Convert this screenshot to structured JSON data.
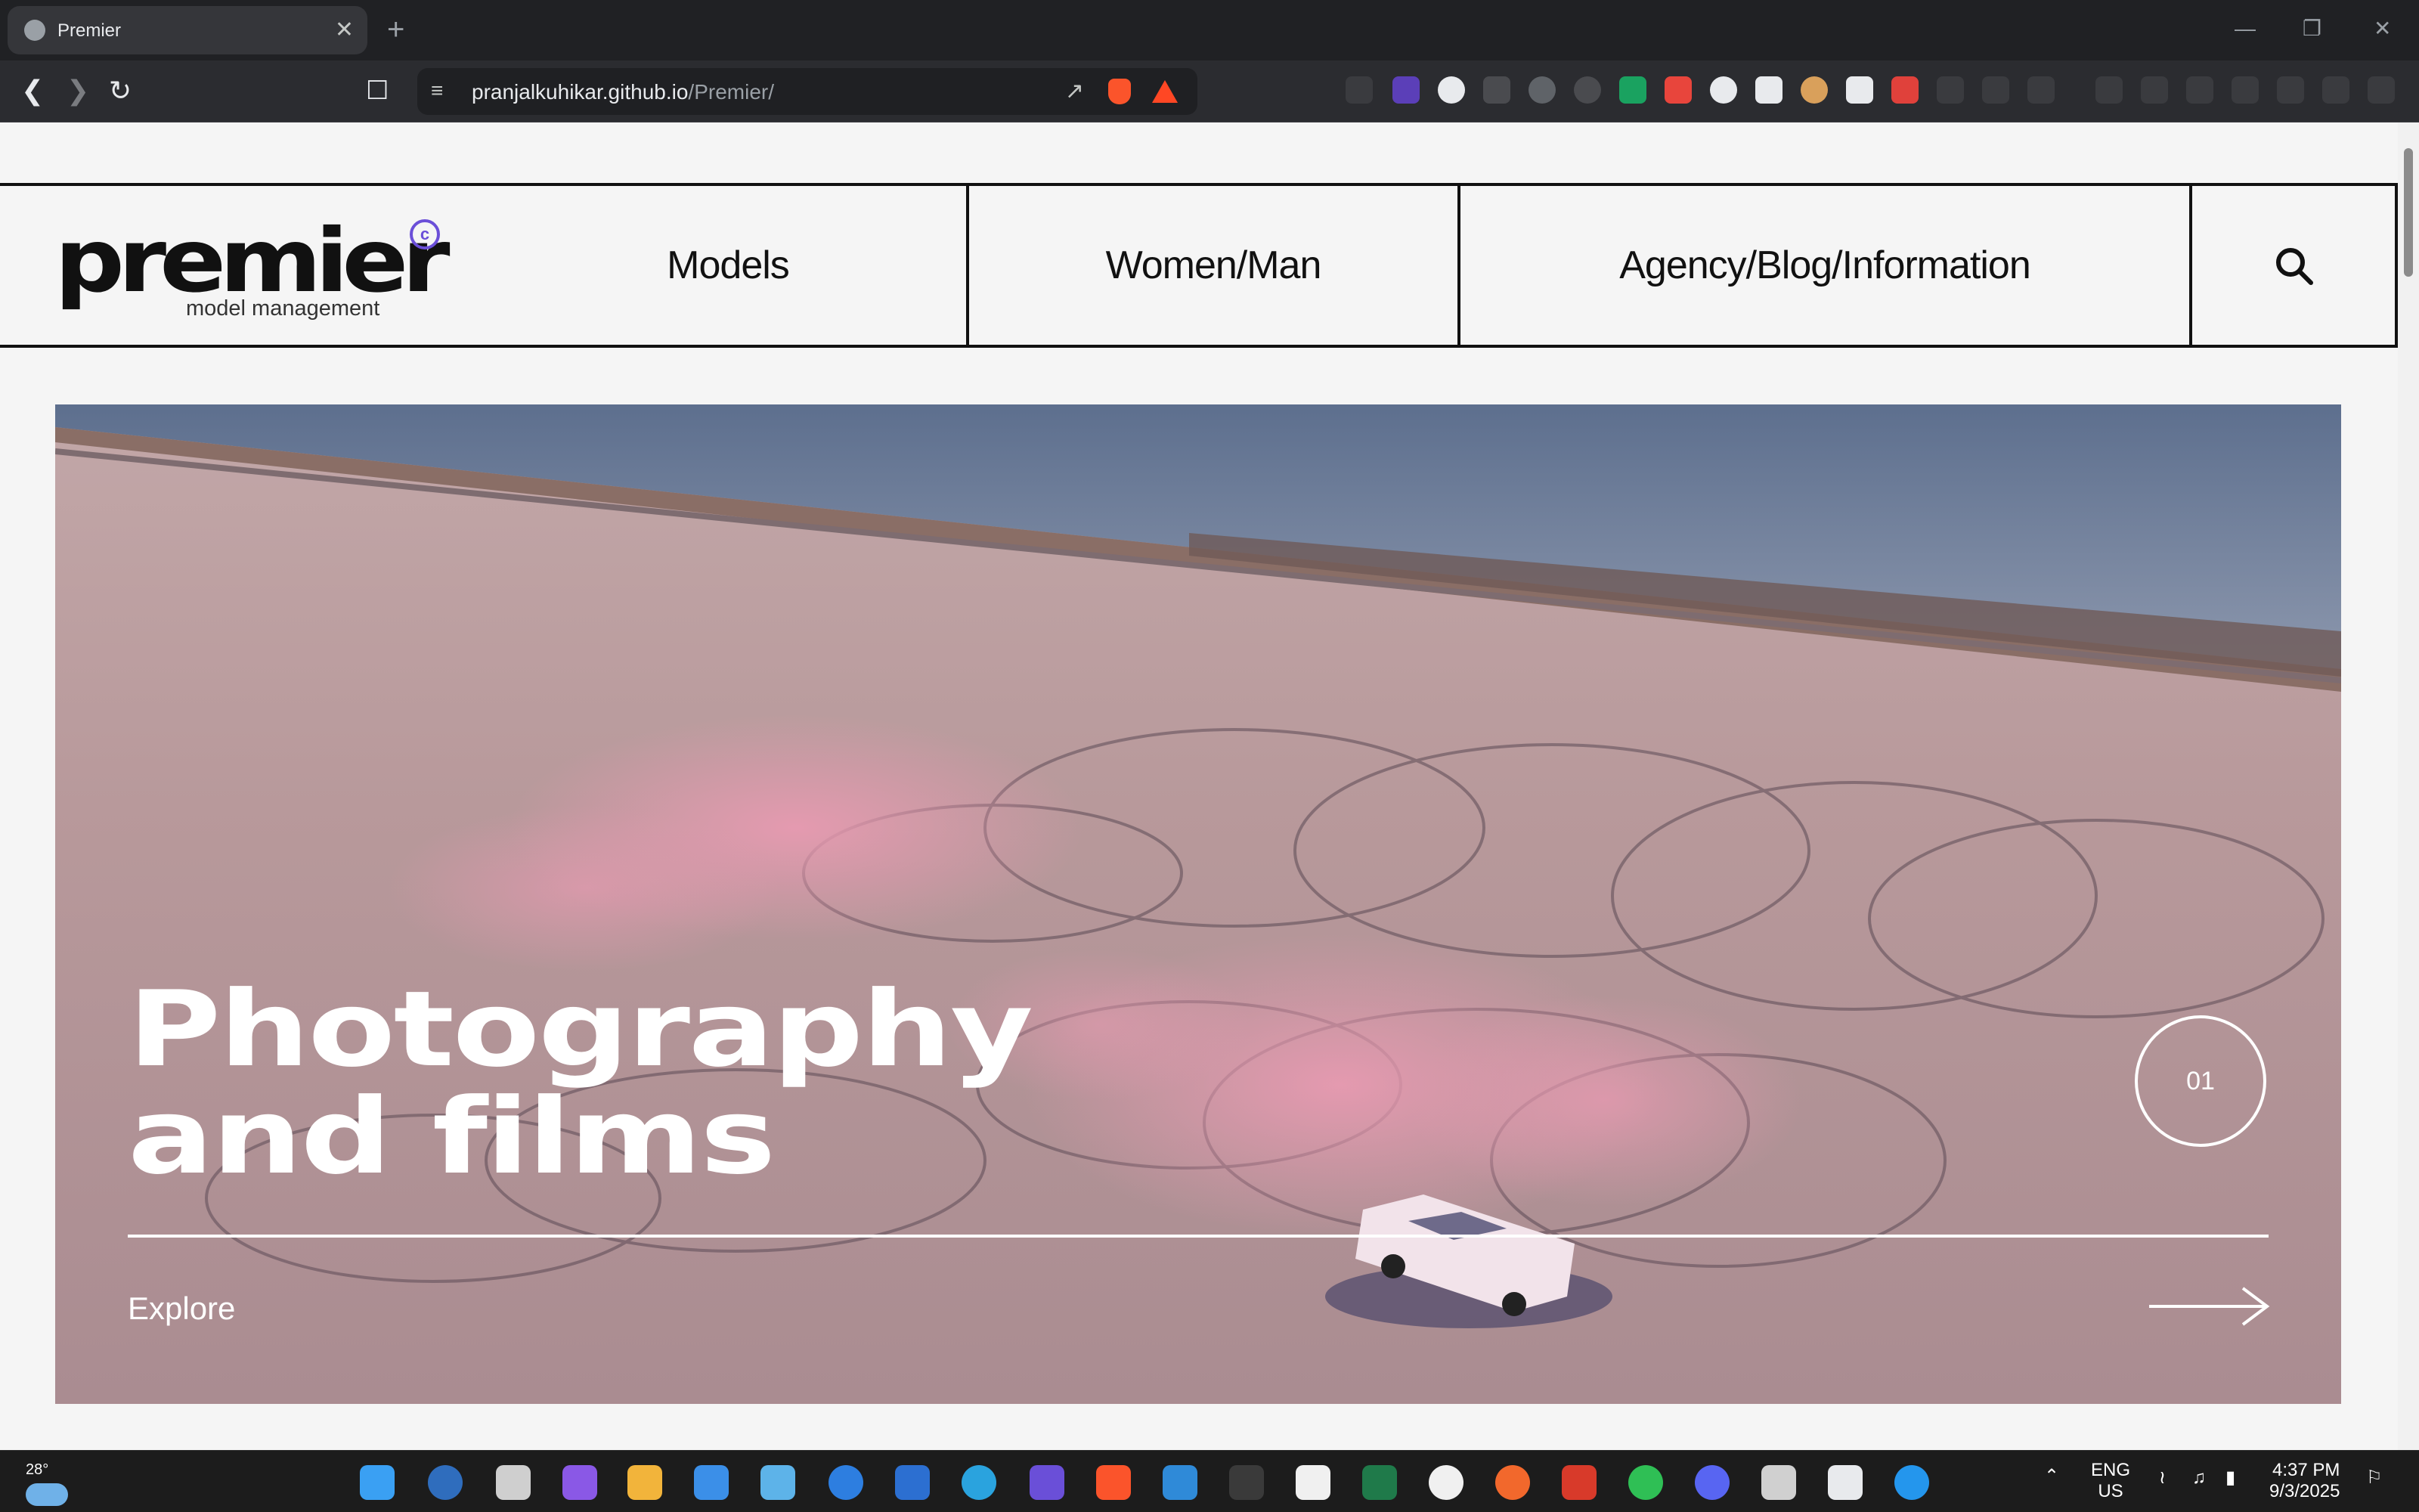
{
  "browser": {
    "tab_title": "Premier",
    "url_host": "pranjalkuhikar.github.io",
    "url_path": "/Premier/"
  },
  "site": {
    "logo_word": "premier",
    "logo_mark": "c",
    "logo_sub": "model management",
    "nav": [
      {
        "label": "Models"
      },
      {
        "label": "Women/Man"
      },
      {
        "label": "Agency/Blog/Information"
      }
    ]
  },
  "hero": {
    "title_line1": "Photography",
    "title_line2": "and films",
    "slide_number": "01",
    "cta": "Explore"
  },
  "taskbar": {
    "temperature": "28°",
    "lang": "ENG",
    "region": "US",
    "time": "4:37 PM",
    "date": "9/3/2025"
  },
  "colors": {
    "accent": "#6b4fd8",
    "ink": "#111111",
    "page_bg": "#f5f5f5"
  }
}
